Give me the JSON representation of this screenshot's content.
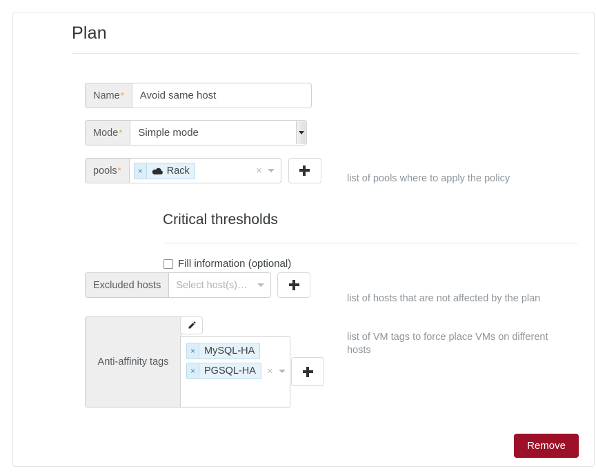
{
  "page": {
    "title": "Plan"
  },
  "fields": {
    "name": {
      "label": "Name",
      "required_marker": "*",
      "value": "Avoid same host"
    },
    "mode": {
      "label": "Mode",
      "required_marker": "*",
      "selected": "Simple mode"
    },
    "pools": {
      "label": "pools",
      "required_marker": "*",
      "tags": [
        {
          "label": "Rack",
          "icon": "cloud-icon",
          "remove": "×"
        }
      ],
      "clear": "×",
      "hint": "list of pools where to apply the policy",
      "add_button": "+"
    },
    "excluded_hosts": {
      "label": "Excluded hosts",
      "placeholder": "Select host(s)…",
      "hint": "list of hosts that are not affected by the plan",
      "add_button": "+"
    },
    "anti_affinity": {
      "label": "Anti-affinity tags",
      "edit_icon": "pencil-icon",
      "tags": [
        {
          "label": "MySQL-HA",
          "remove": "×"
        },
        {
          "label": "PGSQL-HA",
          "remove": "×"
        }
      ],
      "clear": "×",
      "hint": "list of VM tags to force place VMs on different hosts",
      "add_button": "+"
    }
  },
  "sections": {
    "critical_thresholds": {
      "title": "Critical thresholds",
      "fill_info_label": "Fill information (optional)",
      "fill_info_checked": false
    }
  },
  "actions": {
    "remove_label": "Remove"
  },
  "colors": {
    "danger": "#9d1128",
    "required_asterisk": "#e8a33d",
    "tag_blue": "#2a8ac0",
    "hint_text": "#8e959b"
  }
}
